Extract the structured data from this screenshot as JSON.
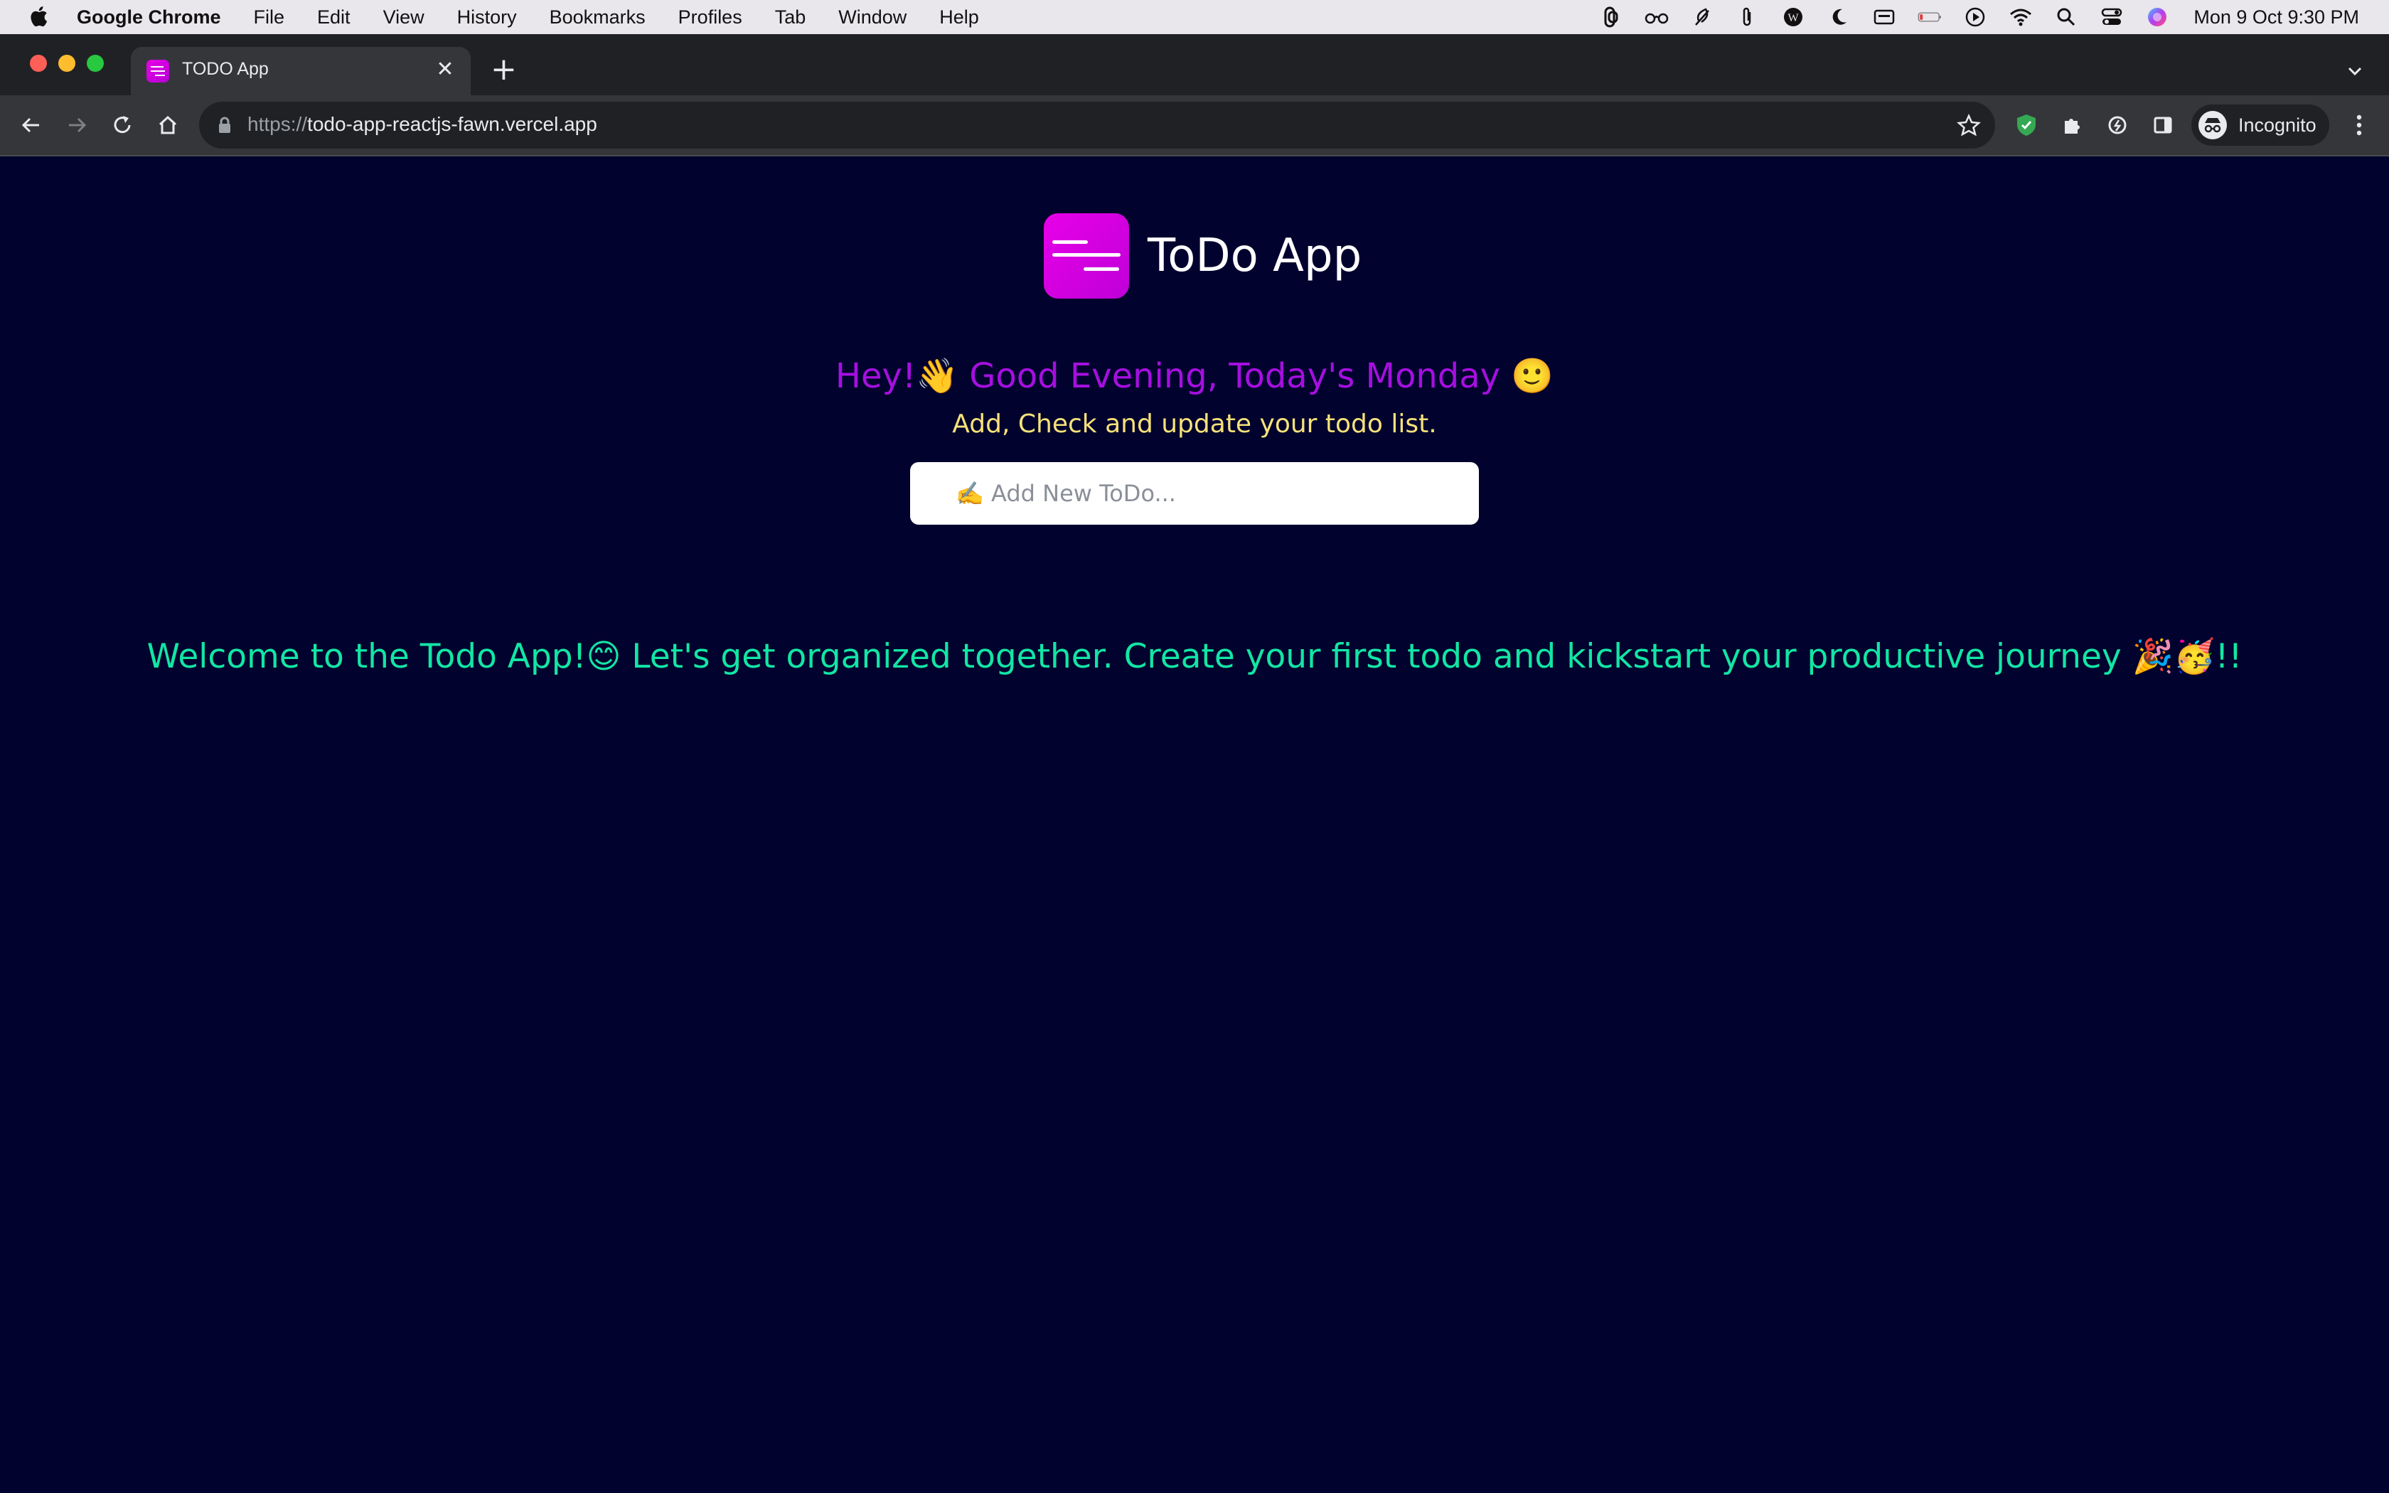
{
  "menubar": {
    "app_name": "Google Chrome",
    "menus": [
      "File",
      "Edit",
      "View",
      "History",
      "Bookmarks",
      "Profiles",
      "Tab",
      "Window",
      "Help"
    ],
    "clock": "Mon 9 Oct  9:30 PM"
  },
  "browser": {
    "tab_title": "TODO App",
    "new_tab_symbol": "+",
    "url_scheme": "https://",
    "url_host": "todo-app-reactjs-fawn.vercel.app",
    "profile_label": "Incognito"
  },
  "app": {
    "name": "ToDo App",
    "greeting": "Hey!👋 Good Evening, Today's Monday 🙂",
    "subtitle": "Add, Check and update your todo list.",
    "input_placeholder": "✍️ Add New ToDo...",
    "welcome_message": "Welcome to the Todo App!😊 Let's get organized together. Create your first todo and kickstart your productive journey 🎉🥳!!"
  },
  "colors": {
    "page_background": "#02022e",
    "logo_gradient_start": "#e800e8",
    "greeting": "#a60fe0",
    "subtitle": "#f6e27a",
    "welcome": "#12e6a4"
  }
}
